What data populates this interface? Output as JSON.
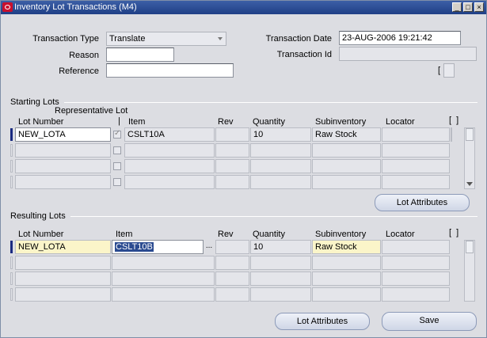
{
  "window": {
    "title": "Inventory Lot Transactions (M4)"
  },
  "header": {
    "transaction_type_label": "Transaction Type",
    "transaction_type_value": "Translate",
    "reason_label": "Reason",
    "reason_value": "",
    "reference_label": "Reference",
    "reference_value": "",
    "transaction_date_label": "Transaction Date",
    "transaction_date_value": "23-AUG-2006 19:21:42",
    "transaction_id_label": "Transaction Id",
    "transaction_id_value": ""
  },
  "starting_lots": {
    "title": "Starting Lots",
    "columns": {
      "representative_lot": "Representative Lot",
      "lot_number": "Lot Number",
      "item": "Item",
      "rev": "Rev",
      "quantity": "Quantity",
      "subinventory": "Subinventory",
      "locator": "Locator"
    },
    "rows": [
      {
        "lot_number": "NEW_LOTA",
        "representative": true,
        "item": "CSLT10A",
        "rev": "",
        "quantity": "10",
        "subinventory": "Raw Stock",
        "locator": ""
      },
      {
        "lot_number": "",
        "representative": false,
        "item": "",
        "rev": "",
        "quantity": "",
        "subinventory": "",
        "locator": ""
      },
      {
        "lot_number": "",
        "representative": false,
        "item": "",
        "rev": "",
        "quantity": "",
        "subinventory": "",
        "locator": ""
      },
      {
        "lot_number": "",
        "representative": false,
        "item": "",
        "rev": "",
        "quantity": "",
        "subinventory": "",
        "locator": ""
      }
    ],
    "lot_attributes_button": "Lot Attributes"
  },
  "resulting_lots": {
    "title": "Resulting Lots",
    "columns": {
      "lot_number": "Lot Number",
      "item": "Item",
      "rev": "Rev",
      "quantity": "Quantity",
      "subinventory": "Subinventory",
      "locator": "Locator"
    },
    "rows": [
      {
        "lot_number": "NEW_LOTA",
        "item": "CSLT10B",
        "rev": "",
        "quantity": "10",
        "subinventory": "Raw Stock",
        "locator": ""
      },
      {
        "lot_number": "",
        "item": "",
        "rev": "",
        "quantity": "",
        "subinventory": "",
        "locator": ""
      },
      {
        "lot_number": "",
        "item": "",
        "rev": "",
        "quantity": "",
        "subinventory": "",
        "locator": ""
      },
      {
        "lot_number": "",
        "item": "",
        "rev": "",
        "quantity": "",
        "subinventory": "",
        "locator": ""
      }
    ],
    "lot_attributes_button": "Lot Attributes",
    "save_button": "Save",
    "lov_glyph": "..."
  },
  "colors": {
    "titlebar": "#2b4c94",
    "highlight_row": "#fbf5c9",
    "selection": "#2a4a90"
  }
}
